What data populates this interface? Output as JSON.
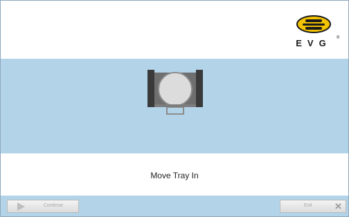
{
  "logo": {
    "text": "EVG",
    "mark": "®"
  },
  "main": {
    "message": "Move Tray In",
    "illustration": "tray-icon"
  },
  "footer": {
    "continue_label": "Continue",
    "exit_label": "Exit",
    "continue_icon": "play-icon",
    "exit_icon": "close-icon"
  },
  "colors": {
    "band": "#b3d4e8",
    "logo_yellow": "#f2c300",
    "text": "#222222"
  }
}
